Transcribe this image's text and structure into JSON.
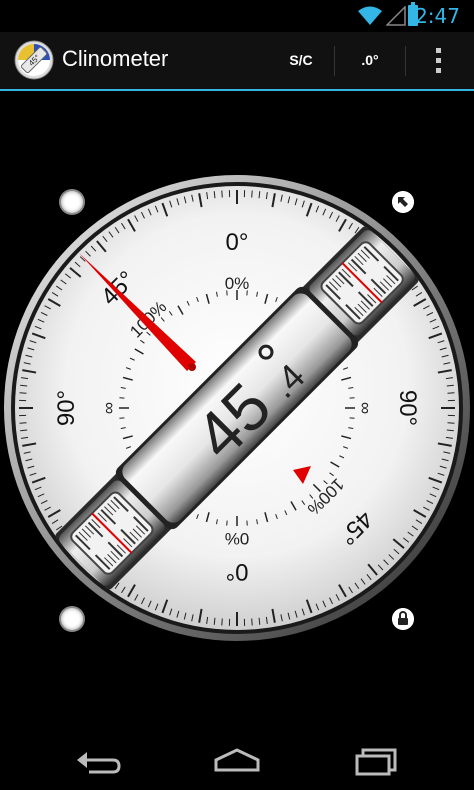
{
  "status_bar": {
    "time": "2:47"
  },
  "action_bar": {
    "title": "Clinometer",
    "app_icon_text": "45°",
    "sc_button": "S/C",
    "decimal_button": ".0°"
  },
  "gauge": {
    "angle_main": "45",
    "angle_decimal": ".4",
    "outer_labels": {
      "top": "0°",
      "bottom": "0°",
      "left": "90°",
      "right": "90°",
      "upper_left": "45°",
      "lower_right": "45°"
    },
    "inner_labels": {
      "top_percent": "0%",
      "bottom_percent": "0%",
      "upper_left_percent": "100%",
      "lower_right_percent": "100%",
      "left_infinity": "∞",
      "right_infinity": "∞"
    }
  },
  "colors": {
    "accent": "#33b5e5",
    "needle": "#e00000",
    "dial_face": "#f4f4f4"
  },
  "icons": [
    "wifi-icon",
    "signal-icon",
    "battery-icon",
    "overflow-menu-icon",
    "calibrate-arrow-icon",
    "lock-icon",
    "back-icon",
    "home-icon",
    "recent-apps-icon"
  ]
}
